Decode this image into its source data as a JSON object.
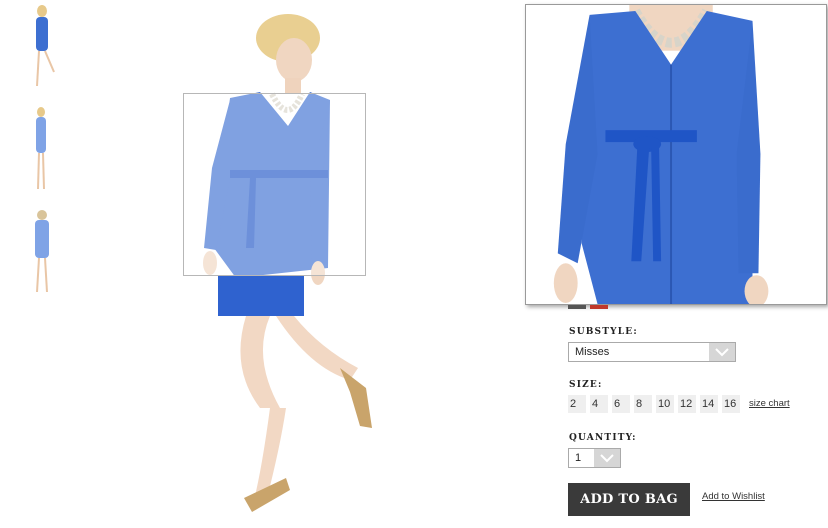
{
  "thumbnails": [
    {
      "name": "front-view"
    },
    {
      "name": "side-view"
    },
    {
      "name": "back-view"
    }
  ],
  "colors": {
    "dress": "#3d6fd1",
    "belt": "#1f55c6",
    "button": "#3a3a3a"
  },
  "options": {
    "substyle_label": "SUBSTYLE:",
    "substyle_value": "Misses",
    "size_label": "SIZE:",
    "sizes": [
      "2",
      "4",
      "6",
      "8",
      "10",
      "12",
      "14",
      "16"
    ],
    "size_chart": "size chart",
    "quantity_label": "QUANTITY:",
    "quantity_value": "1"
  },
  "actions": {
    "add_to_bag": "ADD TO BAG",
    "wishlist": "Add to Wishlist"
  }
}
